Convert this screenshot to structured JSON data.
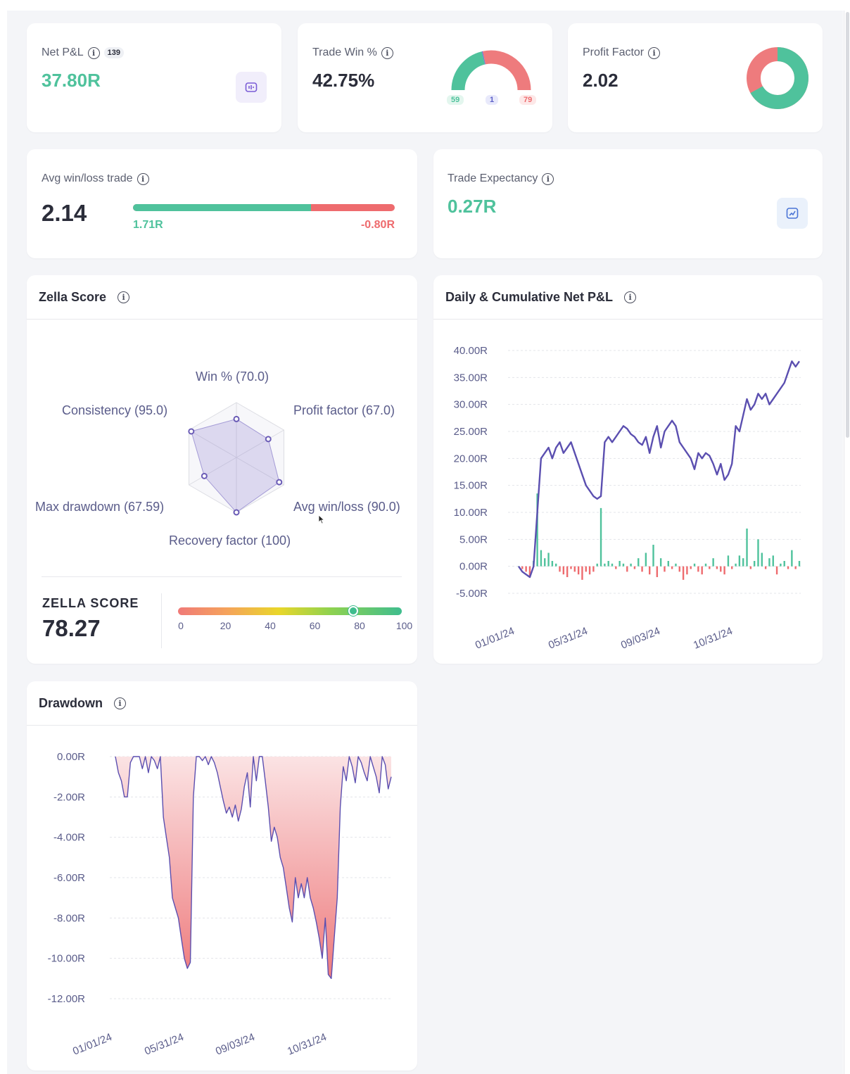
{
  "net_pnl": {
    "label": "Net P&L",
    "count": "139",
    "value": "37.80R"
  },
  "trade_win": {
    "label": "Trade Win %",
    "value": "42.75%",
    "wins": "59",
    "breakeven": "1",
    "losses": "79",
    "win_count": 59,
    "be_count": 1,
    "loss_count": 79
  },
  "profit_factor": {
    "label": "Profit Factor",
    "value": "2.02",
    "ratio": 2.02
  },
  "avg_win_loss": {
    "label": "Avg win/loss trade",
    "value": "2.14",
    "avg_win": "1.71R",
    "avg_loss": "-0.80R",
    "win_share": 0.68
  },
  "trade_expectancy": {
    "label": "Trade Expectancy",
    "value": "0.27R"
  },
  "zella": {
    "title": "Zella Score",
    "score_label": "ZELLA SCORE",
    "score": "78.27",
    "score_value": 78.27,
    "metrics": [
      {
        "label": "Win % (70.0)",
        "value": 70.0
      },
      {
        "label": "Profit factor (67.0)",
        "value": 67.0
      },
      {
        "label": "Avg win/loss (90.0)",
        "value": 90.0
      },
      {
        "label": "Recovery factor (100)",
        "value": 100
      },
      {
        "label": "Max drawdown (67.59)",
        "value": 67.59
      },
      {
        "label": "Consistency (95.0)",
        "value": 95.0
      }
    ],
    "scale_ticks": [
      "0",
      "20",
      "40",
      "60",
      "80",
      "100"
    ]
  },
  "daily_cumulative": {
    "title": "Daily & Cumulative Net P&L",
    "y_ticks": [
      "40.00R",
      "35.00R",
      "30.00R",
      "25.00R",
      "20.00R",
      "15.00R",
      "10.00R",
      "5.00R",
      "0.00R",
      "-5.00R"
    ],
    "x_ticks": [
      "01/01/24",
      "05/31/24",
      "09/03/24",
      "10/31/24"
    ]
  },
  "drawdown": {
    "title": "Drawdown",
    "y_ticks": [
      "0.00R",
      "-2.00R",
      "-4.00R",
      "-6.00R",
      "-8.00R",
      "-10.00R",
      "-12.00R"
    ],
    "x_ticks": [
      "01/01/24",
      "05/31/24",
      "09/03/24",
      "10/31/24"
    ]
  },
  "colors": {
    "green": "#4fc29c",
    "red": "#ee6b6e",
    "purple": "#5b4fb0",
    "text": "#2b2d3a"
  },
  "chart_data": [
    {
      "type": "line",
      "title": "Daily & Cumulative Net P&L",
      "ylim": [
        -5,
        40
      ],
      "x_ticks": [
        "01/01/24",
        "05/31/24",
        "09/03/24",
        "10/31/24"
      ],
      "series": [
        {
          "values": [
            0,
            -1,
            -1.5,
            -2,
            0,
            10,
            20,
            21,
            22,
            20,
            22,
            23,
            21,
            22,
            23,
            21,
            19,
            17,
            15,
            14,
            13,
            12.5,
            13,
            23,
            24,
            23,
            24,
            25,
            26,
            25.5,
            24.5,
            24,
            23,
            22.5,
            24,
            21,
            24,
            26,
            22,
            25,
            26,
            27,
            26,
            23,
            22,
            21,
            20,
            18,
            21,
            20,
            21,
            20.5,
            19,
            17,
            19,
            16,
            17,
            19,
            26,
            25,
            28,
            31,
            29,
            30,
            32,
            31,
            32,
            30,
            31,
            32,
            33,
            34,
            36,
            38,
            37,
            38
          ]
        },
        {
          "values": [
            0,
            -0.5,
            -1,
            -2,
            1,
            13.5,
            3,
            1.5,
            2.5,
            1,
            0.5,
            -1,
            -1.5,
            -2,
            -0.5,
            -1,
            -1.5,
            -2.5,
            -1,
            -1.5,
            -1,
            0.5,
            10.8,
            0.5,
            1,
            0.5,
            -0.5,
            1,
            0.5,
            -1,
            0.5,
            -0.5,
            1.5,
            -1,
            2.5,
            -1.5,
            4,
            -2,
            1.5,
            -1,
            1,
            -0.5,
            0.5,
            -1,
            -2.5,
            -1.5,
            -0.5,
            0.5,
            -1,
            -1.5,
            0.5,
            -0.5,
            1.5,
            -0.5,
            -1,
            -1.5,
            2,
            -0.5,
            0.5,
            2,
            1.5,
            7,
            -0.5,
            1,
            5,
            2.5,
            -0.5,
            1.5,
            2,
            -1.5,
            0.5,
            1,
            -0.5,
            3,
            -0.5,
            1
          ]
        }
      ]
    },
    {
      "type": "area",
      "title": "Drawdown",
      "ylim": [
        -12,
        0
      ],
      "x_ticks": [
        "01/01/24",
        "05/31/24",
        "09/03/24",
        "10/31/24"
      ],
      "series": [
        {
          "values": [
            0,
            -0.8,
            -1.2,
            -2,
            -2,
            -0.3,
            0,
            0,
            0,
            -0.6,
            0,
            -0.8,
            0,
            -0.2,
            -0.6,
            0,
            -3,
            -4,
            -5,
            -7,
            -7.5,
            -8,
            -9,
            -10,
            -10.5,
            -10.2,
            -2,
            0,
            0,
            -0.2,
            0,
            -0.4,
            0,
            -0.3,
            -0.8,
            -1.5,
            -2.2,
            -2.8,
            -2.5,
            -3,
            -2.4,
            -3.2,
            -2.6,
            -1.5,
            -0.8,
            -2.5,
            0,
            -1.2,
            0,
            0,
            -1.2,
            -2.5,
            -4.2,
            -3.5,
            -4,
            -5,
            -5.5,
            -6.5,
            -7.5,
            -8.2,
            -6,
            -7,
            -6.3,
            -7,
            -6,
            -7,
            -7.5,
            -8.2,
            -9,
            -10,
            -8,
            -10.8,
            -11,
            -9,
            -7,
            -2.5,
            -0.5,
            -1.2,
            0,
            -0.5,
            -1.3,
            0,
            -0.3,
            -0.8,
            -1.2,
            0,
            -0.5,
            -1,
            -1.8,
            0,
            -0.4,
            -1.6,
            -1
          ]
        }
      ]
    }
  ]
}
